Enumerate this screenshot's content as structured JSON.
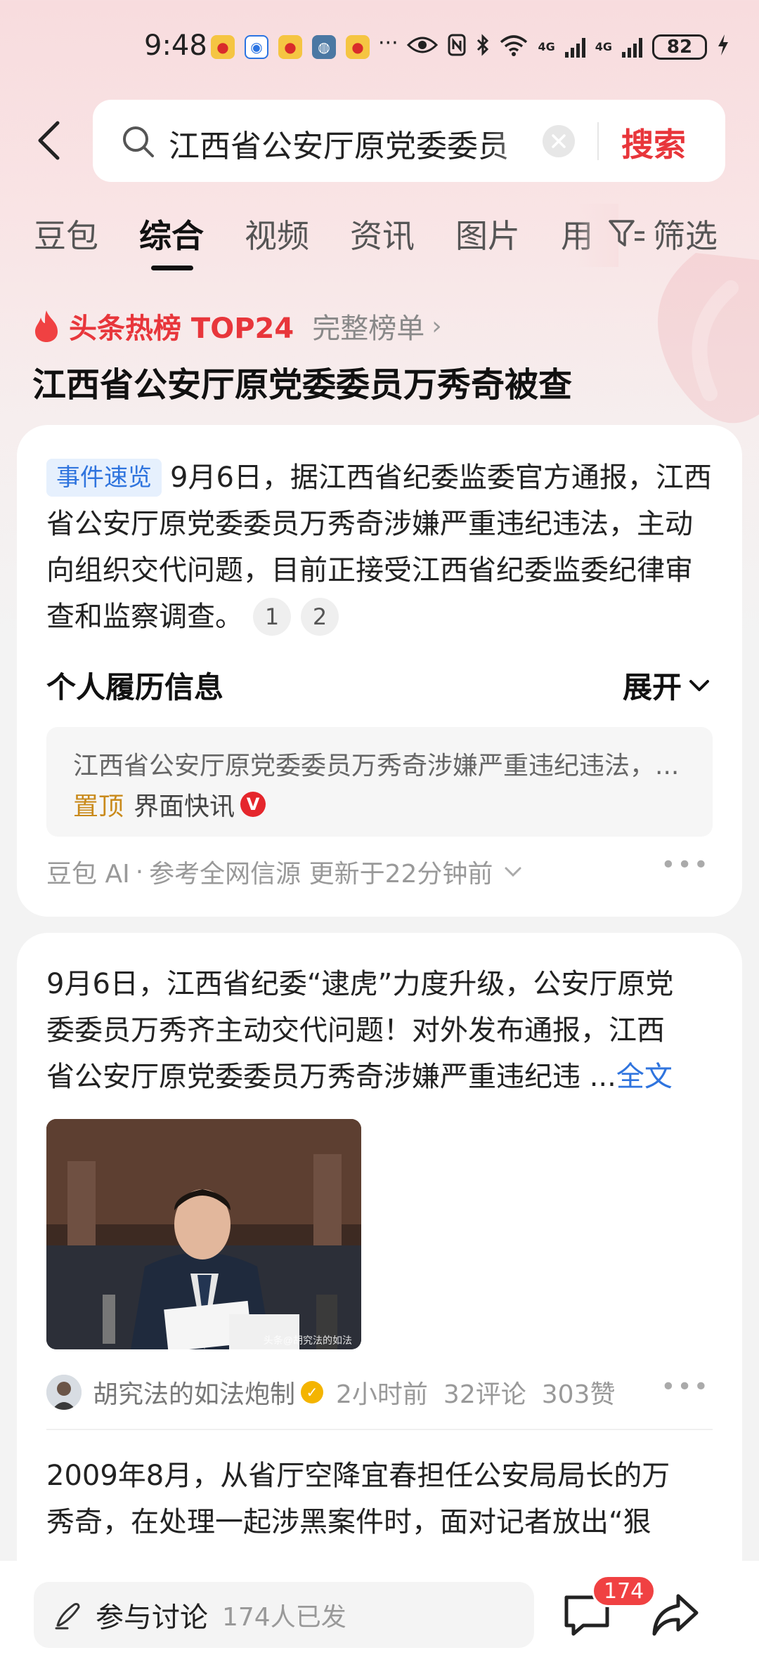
{
  "status_bar": {
    "time": "9:48",
    "more": "···",
    "net1": "4G",
    "net2": "4G",
    "battery": "82"
  },
  "search": {
    "query": "江西省公安厅原党委委员",
    "button_label": "搜索"
  },
  "tabs": {
    "items": [
      "豆包",
      "综合",
      "视频",
      "资讯",
      "图片",
      "用"
    ],
    "active": "综合",
    "filter_label": "筛选"
  },
  "hot": {
    "label": "头条热榜 TOP24",
    "full_list": "完整榜单",
    "title": "江西省公安厅原党委委员万秀奇被查"
  },
  "summary_card": {
    "badge": "事件速览",
    "text": "9月6日，据江西省纪委监委官方通报，江西省公安厅原党委委员万秀奇涉嫌严重违纪违法，主动向组织交代问题，目前正接受江西省纪委监委纪律审查和监察调查。",
    "refs": [
      "1",
      "2"
    ],
    "section_title": "个人履历信息",
    "expand_label": "展开",
    "quote_text": "江西省公安厅原党委委员万秀奇涉嫌严重违纪违法，...",
    "quote_pin": "置顶",
    "quote_source": "界面快讯",
    "quote_badge": "V",
    "ai_source": "豆包 AI",
    "ai_dot": "·",
    "ai_note": "参考全网信源 更新于22分钟前"
  },
  "post_card": {
    "line1": "9月6日，江西省纪委“逮虎”力度升级，公安厅原党",
    "line2": "委委员万秀齐主动交代问题！对外发布通报，江西",
    "line3": "省公安厅原党委委员万秀奇涉嫌严重违纪违",
    "ellipsis": " ...",
    "full_text": "全文",
    "image_watermark": "头条@胡究法的如法",
    "author": "胡究法的如法炮制",
    "time": "2小时前",
    "comments": "32评论",
    "likes": "303赞",
    "post2_line1": "2009年8月，从省厅空降宜春担任公安局局长的万",
    "post2_line2": "秀奇，在处理一起涉黑案件时，面对记者放出“狠"
  },
  "bottom_bar": {
    "discuss_label": "参与讨论",
    "discuss_count": "174人已发",
    "comment_badge": "174"
  },
  "colors": {
    "accent_red": "#e8363b",
    "link_blue": "#2f74de",
    "pin_gold": "#c98a1b"
  }
}
